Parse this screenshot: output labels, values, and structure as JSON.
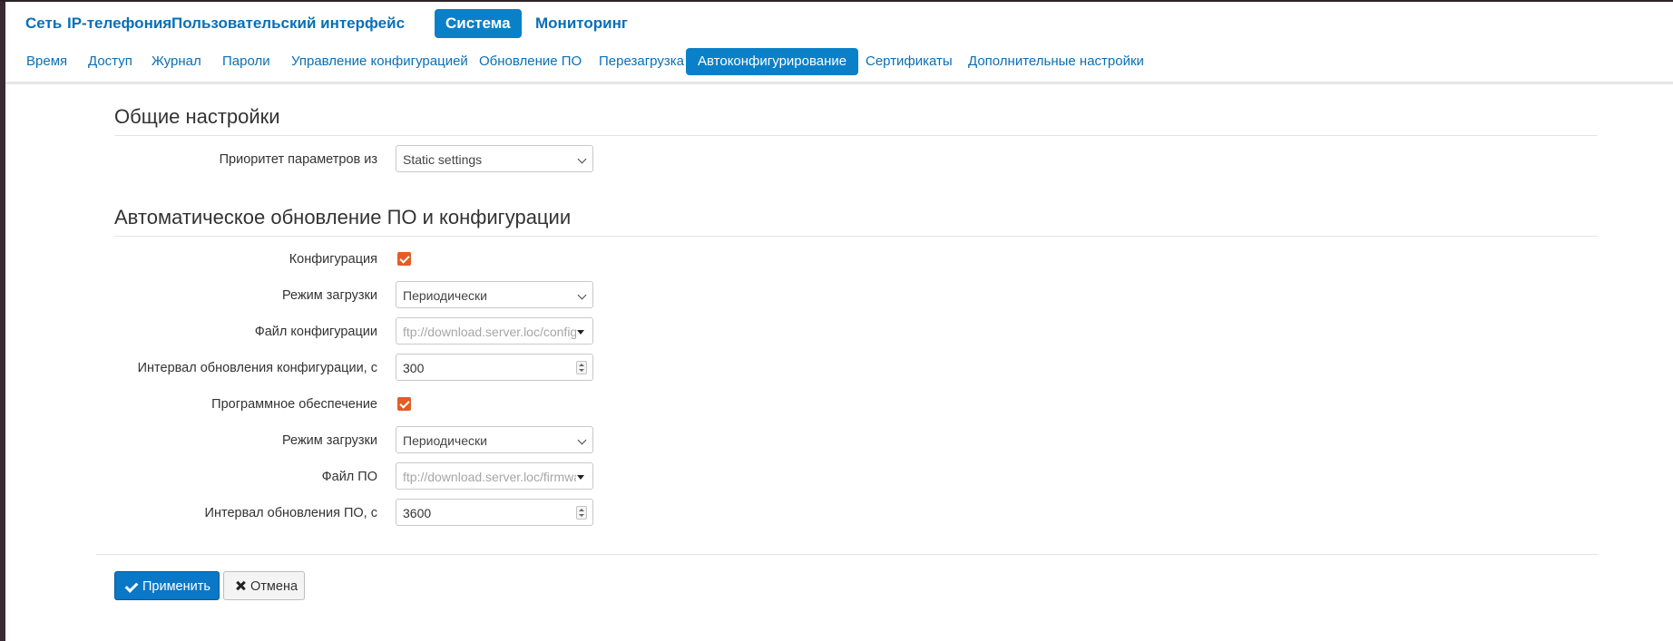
{
  "main_nav": {
    "items": [
      "Сеть",
      "IP-телефония",
      "Пользовательский интерфейс",
      "Система",
      "Мониторинг"
    ],
    "active": "Система"
  },
  "sub_nav": {
    "items": [
      "Время",
      "Доступ",
      "Журнал",
      "Пароли",
      "Управление конфигурацией",
      "Обновление ПО",
      "Перезагрузка",
      "Автоконфигурирование",
      "Сертификаты",
      "Дополнительные настройки"
    ],
    "active": "Автоконфигурирование"
  },
  "general": {
    "title": "Общие настройки",
    "priority_label": "Приоритет параметров из",
    "priority_value": "Static settings"
  },
  "auto_update": {
    "title": "Автоматическое обновление ПО и конфигурации",
    "config_label": "Конфигурация",
    "config_checked": true,
    "config_mode_label": "Режим загрузки",
    "config_mode_value": "Периодически",
    "config_file_label": "Файл конфигурации",
    "config_file_placeholder": "ftp://download.server.loc/config",
    "config_interval_label": "Интервал обновления конфигурации, с",
    "config_interval_value": "300",
    "fw_label": "Программное обеспечение",
    "fw_checked": true,
    "fw_mode_label": "Режим загрузки",
    "fw_mode_value": "Периодически",
    "fw_file_label": "Файл ПО",
    "fw_file_placeholder": "ftp://download.server.loc/firmware",
    "fw_interval_label": "Интервал обновления ПО, с",
    "fw_interval_value": "3600"
  },
  "buttons": {
    "apply": "Применить",
    "cancel": "Отмена"
  },
  "colors": {
    "accent": "#0a80c8",
    "link": "#0a6fb6",
    "checkbox": "#e35d25"
  }
}
